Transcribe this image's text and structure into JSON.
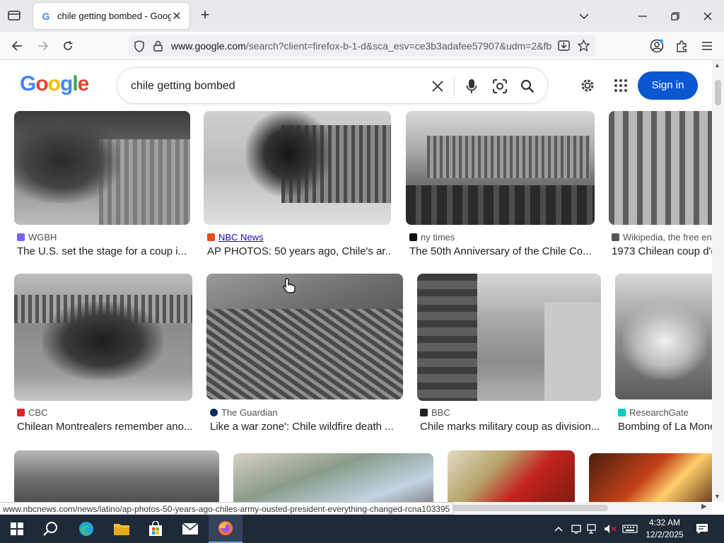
{
  "browser": {
    "tab_title": "chile getting bombed - Google",
    "url_domain": "www.google.com",
    "url_path": "/search?client=firefox-b-1-d&sca_esv=ce3b3adafee57907&udm=2&fb",
    "status_url": "www.nbcnews.com/news/latino/ap-photos-50-years-ago-chiles-army-ousted-president-everything-changed-rcna103395"
  },
  "google": {
    "query": "chile getting bombed",
    "signin_label": "Sign in"
  },
  "results": [
    {
      "source": "WGBH",
      "caption": "The U.S. set the stage for a coup i...",
      "icon_color": "#7b61ff"
    },
    {
      "source": "NBC News",
      "caption": "AP PHOTOS: 50 years ago, Chile's ar...",
      "icon_color": "#e94e1b"
    },
    {
      "source": "ny times",
      "caption": "The 50th Anniversary of the Chile Co...",
      "icon_color": "#111111"
    },
    {
      "source": "Wikipedia, the free enc",
      "caption": "1973 Chilean coup d'é",
      "icon_color": "#555555"
    },
    {
      "source": "CBC",
      "caption": "Chilean Montrealers remember ano...",
      "icon_color": "#d9262b"
    },
    {
      "source": "The Guardian",
      "caption": "Like a war zone': Chile wildfire death ...",
      "icon_color": "#052962"
    },
    {
      "source": "BBC",
      "caption": "Chile marks military coup as division...",
      "icon_color": "#222222"
    },
    {
      "source": "ResearchGate",
      "caption": "Bombing of La Mone",
      "icon_color": "#00ccbb"
    }
  ],
  "taskbar": {
    "time": "4:32 AM",
    "date": "12/2/2025"
  }
}
